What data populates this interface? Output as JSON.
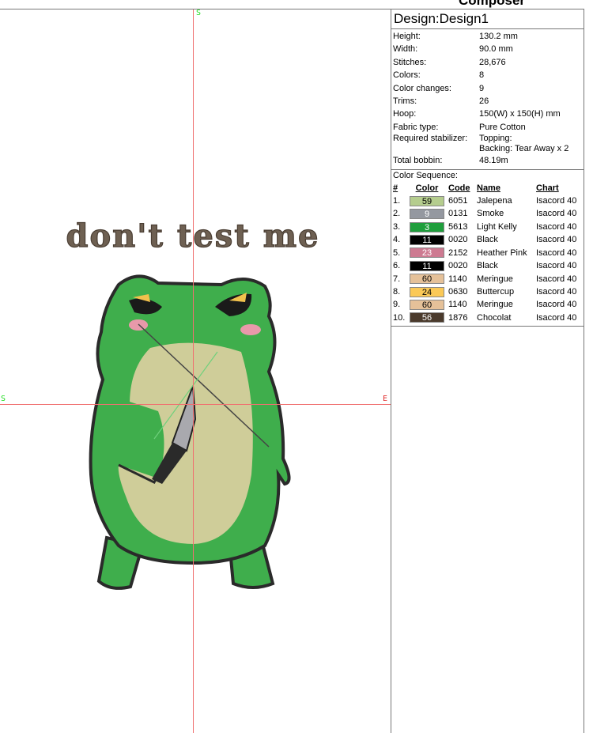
{
  "app_title": "Composer",
  "canvas": {
    "axis_top": "S",
    "axis_left": "S",
    "axis_right": "E",
    "design_text": "don't test me"
  },
  "panel": {
    "title": "Design:Design1",
    "info": [
      {
        "label": "Height:",
        "value": "130.2 mm"
      },
      {
        "label": "Width:",
        "value": "90.0 mm"
      },
      {
        "label": "Stitches:",
        "value": "28,676"
      },
      {
        "label": "Colors:",
        "value": "8"
      },
      {
        "label": "Color changes:",
        "value": "9"
      },
      {
        "label": "Trims:",
        "value": "26"
      },
      {
        "label": "Hoop:",
        "value": "150(W) x 150(H) mm"
      },
      {
        "label": "Fabric type:",
        "value": "Pure Cotton"
      },
      {
        "label": "Required stabilizer:",
        "value": "Topping:",
        "value2": "Backing: Tear Away x 2"
      },
      {
        "label": "Total bobbin:",
        "value": "48.19m"
      }
    ],
    "sequence_title": "Color Sequence:",
    "headers": {
      "num": "#",
      "color": "Color",
      "code": "Code",
      "name": "Name",
      "chart": "Chart"
    },
    "sequence": [
      {
        "num": "1.",
        "swatch": "59",
        "hex": "#b5cd8e",
        "text": "#000",
        "code": "6051",
        "name": "Jalepena",
        "chart": "Isacord 40"
      },
      {
        "num": "2.",
        "swatch": "9",
        "hex": "#9498a0",
        "text": "#fff",
        "code": "0131",
        "name": "Smoke",
        "chart": "Isacord 40"
      },
      {
        "num": "3.",
        "swatch": "3",
        "hex": "#1f9e3c",
        "text": "#fff",
        "code": "5613",
        "name": "Light Kelly",
        "chart": "Isacord 40"
      },
      {
        "num": "4.",
        "swatch": "11",
        "hex": "#000000",
        "text": "#fff",
        "code": "0020",
        "name": "Black",
        "chart": "Isacord 40"
      },
      {
        "num": "5.",
        "swatch": "23",
        "hex": "#cd7a91",
        "text": "#fff",
        "code": "2152",
        "name": "Heather Pink",
        "chart": "Isacord 40"
      },
      {
        "num": "6.",
        "swatch": "11",
        "hex": "#000000",
        "text": "#fff",
        "code": "0020",
        "name": "Black",
        "chart": "Isacord 40"
      },
      {
        "num": "7.",
        "swatch": "60",
        "hex": "#e5c199",
        "text": "#000",
        "code": "1140",
        "name": "Meringue",
        "chart": "Isacord 40"
      },
      {
        "num": "8.",
        "swatch": "24",
        "hex": "#fbc957",
        "text": "#000",
        "code": "0630",
        "name": "Buttercup",
        "chart": "Isacord 40"
      },
      {
        "num": "9.",
        "swatch": "60",
        "hex": "#e5c199",
        "text": "#000",
        "code": "1140",
        "name": "Meringue",
        "chart": "Isacord 40"
      },
      {
        "num": "10.",
        "swatch": "56",
        "hex": "#4a3a2c",
        "text": "#fff",
        "code": "1876",
        "name": "Chocolat",
        "chart": "Isacord 40"
      }
    ]
  }
}
